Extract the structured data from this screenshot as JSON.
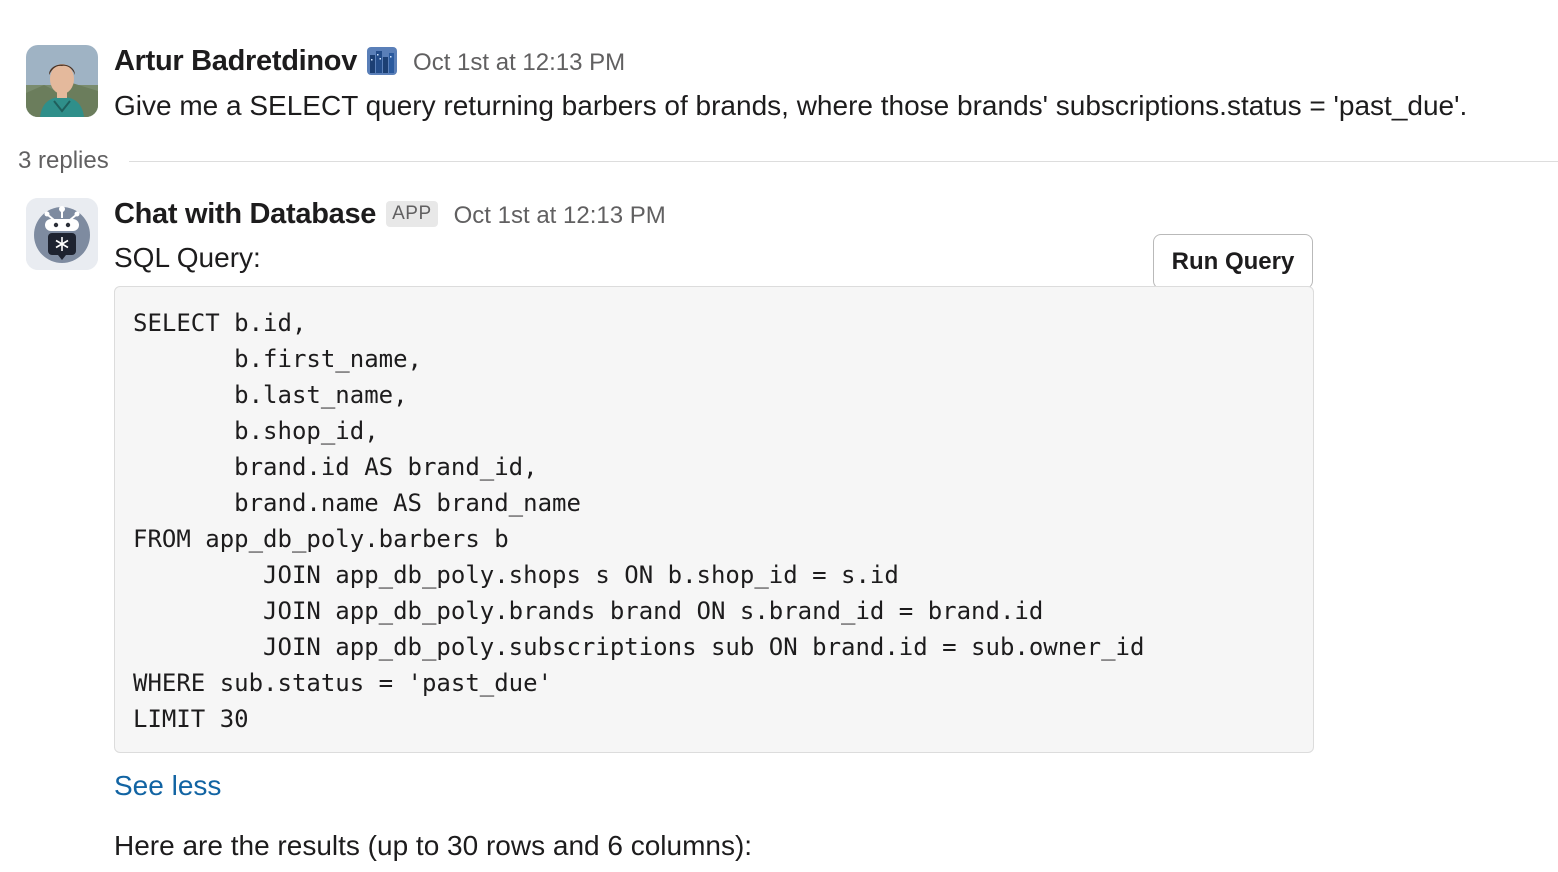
{
  "messages": [
    {
      "author": "Artur Badretdinov",
      "status_emoji": "city-skyline-icon",
      "timestamp": "Oct 1st at 12:13 PM",
      "text": "Give me a SELECT query returning barbers of brands, where those brands' subscriptions.status = 'past_due'."
    },
    {
      "author": "Chat with Database",
      "badge": "APP",
      "timestamp": "Oct 1st at 12:13 PM",
      "sql_label": "SQL Query:",
      "run_button_label": "Run Query",
      "code": "SELECT b.id,\n       b.first_name,\n       b.last_name,\n       b.shop_id,\n       brand.id AS brand_id,\n       brand.name AS brand_name\nFROM app_db_poly.barbers b\n         JOIN app_db_poly.shops s ON b.shop_id = s.id\n         JOIN app_db_poly.brands brand ON s.brand_id = brand.id\n         JOIN app_db_poly.subscriptions sub ON brand.id = sub.owner_id\nWHERE sub.status = 'past_due'\nLIMIT 30",
      "see_less_label": "See less",
      "results_text": "Here are the results (up to 30 rows and 6 columns):"
    }
  ],
  "thread": {
    "replies_label": "3 replies"
  },
  "colors": {
    "link": "#1264a3",
    "muted": "#616061",
    "code_bg": "#f6f6f6"
  }
}
